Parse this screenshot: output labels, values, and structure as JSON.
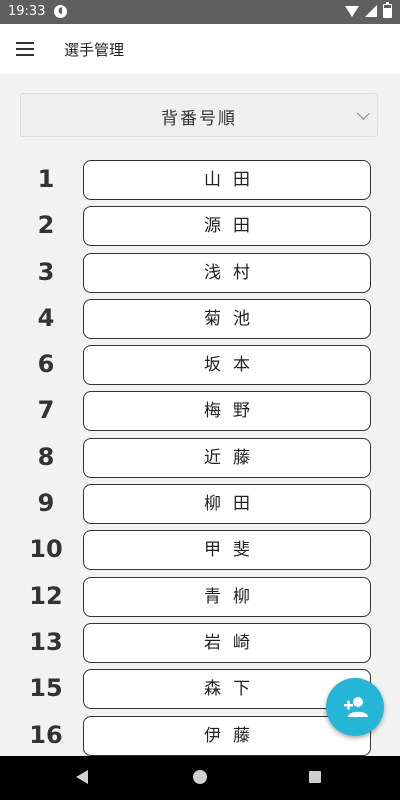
{
  "status_bar": {
    "time": "19:33",
    "app_icon_glyph": "◖"
  },
  "app_bar": {
    "title": "選手管理",
    "menu_icon": "menu-icon"
  },
  "sort": {
    "selected": "背番号順"
  },
  "players": [
    {
      "number": "1",
      "name": "山田"
    },
    {
      "number": "2",
      "name": "源田"
    },
    {
      "number": "3",
      "name": "浅村"
    },
    {
      "number": "4",
      "name": "菊池"
    },
    {
      "number": "6",
      "name": "坂本"
    },
    {
      "number": "7",
      "name": "梅野"
    },
    {
      "number": "8",
      "name": "近藤"
    },
    {
      "number": "9",
      "name": "柳田"
    },
    {
      "number": "10",
      "name": "甲斐"
    },
    {
      "number": "12",
      "name": "青柳"
    },
    {
      "number": "13",
      "name": "岩崎"
    },
    {
      "number": "15",
      "name": "森下"
    },
    {
      "number": "16",
      "name": "伊藤"
    }
  ],
  "fab": {
    "icon": "person-add-icon",
    "color": "#25b5d7"
  },
  "colors": {
    "status_bar": "#5f5f5f",
    "background": "#f2f2f2",
    "accent": "#25b5d7"
  }
}
